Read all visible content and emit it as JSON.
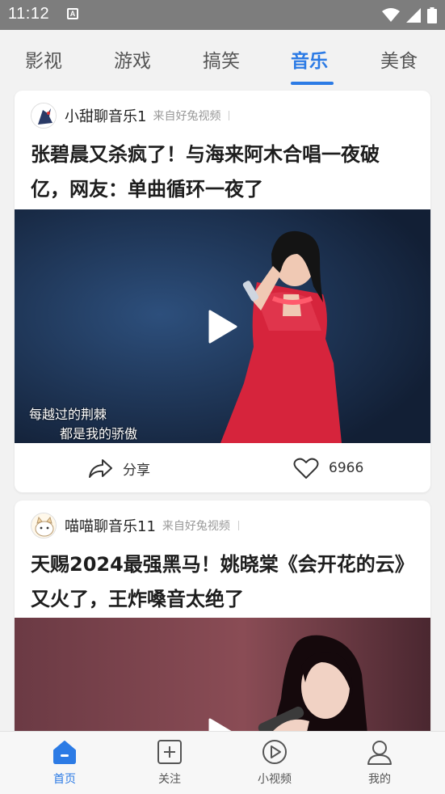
{
  "status_bar": {
    "time": "11:12",
    "notification_glyph": "A",
    "icons": [
      "wifi-icon",
      "signal-icon",
      "battery-icon"
    ]
  },
  "tabs": [
    {
      "label": "影视",
      "active": false
    },
    {
      "label": "游戏",
      "active": false
    },
    {
      "label": "搞笑",
      "active": false
    },
    {
      "label": "音乐",
      "active": true
    },
    {
      "label": "美食",
      "active": false
    }
  ],
  "feed": [
    {
      "author": "小甜聊音乐1",
      "source": "来自好兔视频",
      "title": "张碧晨又杀疯了！与海来阿木合唱一夜破亿，网友：单曲循环一夜了",
      "subtitle_line1": "每越过的荆棘",
      "subtitle_line2": "都是我的骄傲",
      "share_label": "分享",
      "like_count": "6966"
    },
    {
      "author": "喵喵聊音乐11",
      "source": "来自好兔视频",
      "title": "天赐2024最强黑马！姚晓棠《会开花的云》又火了，王炸嗓音太绝了"
    }
  ],
  "bottom_nav": [
    {
      "label": "首页",
      "icon": "home-icon",
      "active": true
    },
    {
      "label": "关注",
      "icon": "add-box-icon",
      "active": false
    },
    {
      "label": "小视频",
      "icon": "play-circle-icon",
      "active": false
    },
    {
      "label": "我的",
      "icon": "user-icon",
      "active": false
    }
  ],
  "colors": {
    "accent": "#2c7be5",
    "status_bar": "#7d7d7d",
    "background": "#f2f2f2"
  }
}
